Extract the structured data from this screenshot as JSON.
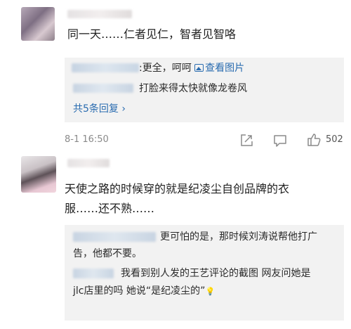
{
  "comments": [
    {
      "text": "同一天……仁者见仁，智者见智咯",
      "replies_line1_sep": ":",
      "replies_line1_text": "更全，呵呵",
      "view_image_label": "查看图片",
      "replies_line2_text": "打脸来得太快就像龙卷风",
      "more_replies_label": "共5条回复",
      "more_replies_chevron": "›",
      "timestamp": "8-1 16:50",
      "like_count": "502"
    },
    {
      "text_line1": "天使之路的时候穿的就是纪凌尘自创品牌的衣",
      "text_line2": "服……还不熟……",
      "reply1_line1": "更可怕的是，那时候刘涛说帮他打广",
      "reply1_line2": "告，他都不要。",
      "reply2_line1": "我看到别人发的王艺评论的截图 网友问她是",
      "reply2_line2": "jlc店里的吗 她说“是纪凌尘的”",
      "reply2_emoji": "💡"
    }
  ],
  "colors": {
    "link_blue": "#2a6cb0",
    "reply_bg": "#f2f2f2",
    "meta_gray": "#8a8a8a"
  },
  "icons": [
    "image-icon",
    "share-icon",
    "comment-icon",
    "like-icon"
  ]
}
